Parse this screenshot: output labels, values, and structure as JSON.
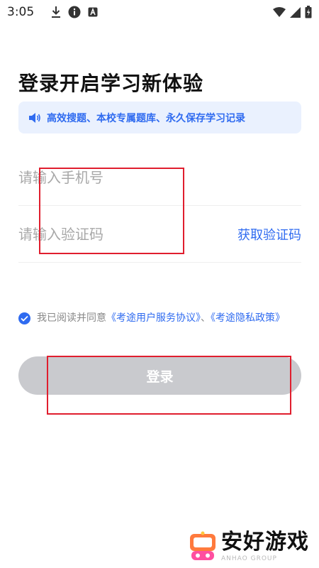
{
  "status_bar": {
    "time": "3:05",
    "left_icons": [
      "download-icon",
      "info-icon",
      "a-badge-icon"
    ],
    "right_icons": [
      "wifi-icon",
      "signal-icon",
      "battery-icon"
    ]
  },
  "page": {
    "title": "登录开启学习新体验",
    "notice": {
      "icon": "speaker-icon",
      "text": "高效搜题、本校专属题库、永久保存学习记录"
    }
  },
  "form": {
    "phone": {
      "value": "",
      "placeholder": "请输入手机号"
    },
    "code": {
      "value": "",
      "placeholder": "请输入验证码",
      "get_code_label": "获取验证码"
    }
  },
  "agreement": {
    "checked": true,
    "prefix": "我已阅读并同意",
    "service_link": "《考途用户服务协议》",
    "separator": "、",
    "privacy_link": "《考途隐私政策》"
  },
  "login_button": {
    "label": "登录",
    "enabled": false
  },
  "watermark": {
    "text": "安好游戏",
    "subtext": "ANHAO GROUP"
  },
  "colors": {
    "accent": "#2f6bf0",
    "notice_bg": "#eaf1fe",
    "button_disabled": "#c9cace",
    "annotation_red": "#e01e2e"
  }
}
